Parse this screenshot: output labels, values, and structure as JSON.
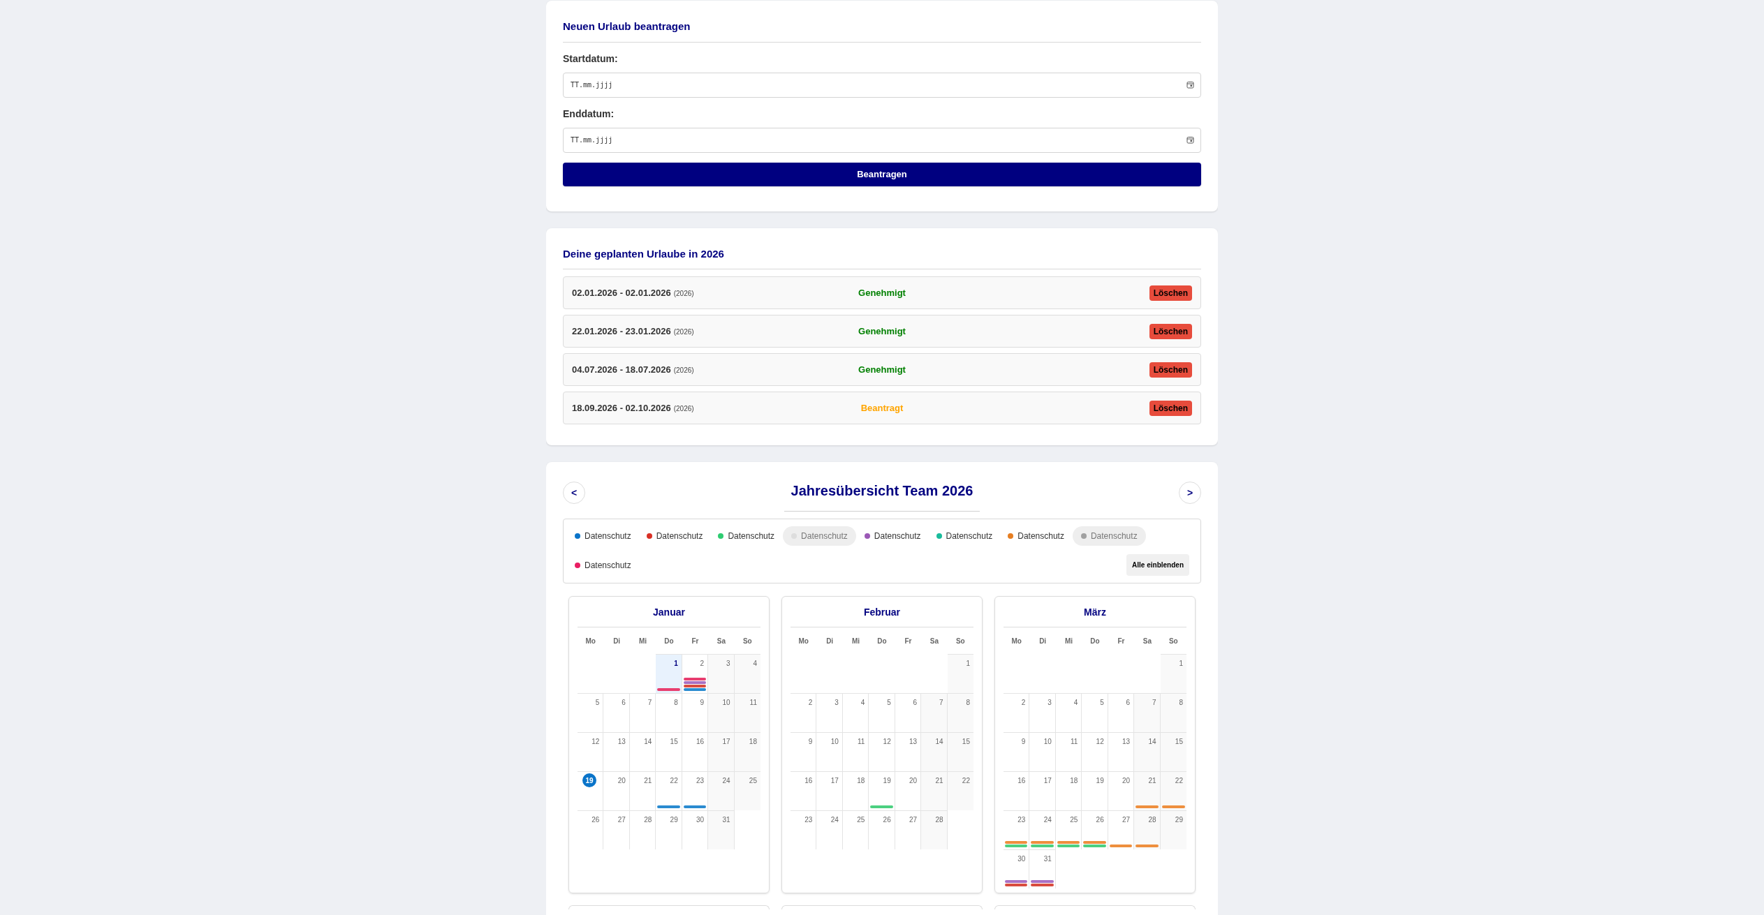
{
  "request_form": {
    "title": "Neuen Urlaub beantragen",
    "fields": [
      {
        "label": "Startdatum:",
        "placeholder": "TT.mm.jjjj"
      },
      {
        "label": "Enddatum:",
        "placeholder": "TT.mm.jjjj"
      }
    ],
    "submit": "Beantragen"
  },
  "planned": {
    "title": "Deine geplanten Urlaube in 2026",
    "items": [
      {
        "range": "02.01.2026 - 02.01.2026",
        "year": "(2026)",
        "status": "Genehmigt",
        "kind": "approved",
        "delete": "Löschen"
      },
      {
        "range": "22.01.2026 - 23.01.2026",
        "year": "(2026)",
        "status": "Genehmigt",
        "kind": "approved",
        "delete": "Löschen"
      },
      {
        "range": "04.07.2026 - 18.07.2026",
        "year": "(2026)",
        "status": "Genehmigt",
        "kind": "approved",
        "delete": "Löschen"
      },
      {
        "range": "18.09.2026 - 02.10.2026",
        "year": "(2026)",
        "status": "Beantragt",
        "kind": "requested",
        "delete": "Löschen"
      }
    ]
  },
  "overview": {
    "prev": "<",
    "title": "Jahresübersicht Team 2026",
    "next": ">",
    "legend": [
      {
        "label": "Datenschutz",
        "color": "#0a74c9",
        "hidden": false
      },
      {
        "label": "Datenschutz",
        "color": "#d93025",
        "hidden": false
      },
      {
        "label": "Datenschutz",
        "color": "#2ecc71",
        "hidden": false
      },
      {
        "label": "Datenschutz",
        "color": "#dddddd",
        "hidden": true
      },
      {
        "label": "Datenschutz",
        "color": "#9b59b6",
        "hidden": false
      },
      {
        "label": "Datenschutz",
        "color": "#1abc9c",
        "hidden": false
      },
      {
        "label": "Datenschutz",
        "color": "#e67e22",
        "hidden": false
      },
      {
        "label": "Datenschutz",
        "color": "#a0a0a0",
        "hidden": true
      },
      {
        "label": "Datenschutz",
        "color": "#e91e63",
        "hidden": false
      }
    ],
    "show_all": "Alle einblenden",
    "months": [
      {
        "name": "Januar",
        "weekdays": [
          "Mo",
          "Di",
          "Mi",
          "Do",
          "Fr",
          "Sa",
          "So"
        ],
        "weeks": [
          [
            {
              "kind": "empty"
            },
            {
              "kind": "empty"
            },
            {
              "kind": "empty"
            },
            {
              "day": "1",
              "kind": "holiday",
              "bars": [
                {
                  "color": "#e83e6f"
                }
              ]
            },
            {
              "day": "2",
              "kind": "weekday",
              "bars": [
                {
                  "color": "#e83e6f"
                },
                {
                  "color": "#a970c4"
                },
                {
                  "color": "#d94c3f"
                },
                {
                  "color": "#2a8bd0"
                }
              ]
            },
            {
              "day": "3",
              "kind": "weekend"
            },
            {
              "day": "4",
              "kind": "weekend"
            }
          ],
          [
            {
              "day": "5",
              "kind": "weekday"
            },
            {
              "day": "6",
              "kind": "weekday"
            },
            {
              "day": "7",
              "kind": "weekday"
            },
            {
              "day": "8",
              "kind": "weekday"
            },
            {
              "day": "9",
              "kind": "weekday"
            },
            {
              "day": "10",
              "kind": "weekend"
            },
            {
              "day": "11",
              "kind": "weekend"
            }
          ],
          [
            {
              "day": "12",
              "kind": "weekday"
            },
            {
              "day": "13",
              "kind": "weekday"
            },
            {
              "day": "14",
              "kind": "weekday"
            },
            {
              "day": "15",
              "kind": "weekday"
            },
            {
              "day": "16",
              "kind": "weekday"
            },
            {
              "day": "17",
              "kind": "weekend"
            },
            {
              "day": "18",
              "kind": "weekend"
            }
          ],
          [
            {
              "day": "19",
              "kind": "today"
            },
            {
              "day": "20",
              "kind": "weekday"
            },
            {
              "day": "21",
              "kind": "weekday"
            },
            {
              "day": "22",
              "kind": "weekday",
              "bars": [
                {
                  "color": "#2a8bd0"
                }
              ]
            },
            {
              "day": "23",
              "kind": "weekday",
              "bars": [
                {
                  "color": "#2a8bd0"
                }
              ]
            },
            {
              "day": "24",
              "kind": "weekend"
            },
            {
              "day": "25",
              "kind": "weekend"
            }
          ],
          [
            {
              "day": "26",
              "kind": "weekday"
            },
            {
              "day": "27",
              "kind": "weekday"
            },
            {
              "day": "28",
              "kind": "weekday"
            },
            {
              "day": "29",
              "kind": "weekday"
            },
            {
              "day": "30",
              "kind": "weekday"
            },
            {
              "day": "31",
              "kind": "weekend"
            },
            {
              "kind": "empty"
            }
          ]
        ]
      },
      {
        "name": "Februar",
        "weekdays": [
          "Mo",
          "Di",
          "Mi",
          "Do",
          "Fr",
          "Sa",
          "So"
        ],
        "weeks": [
          [
            {
              "kind": "empty"
            },
            {
              "kind": "empty"
            },
            {
              "kind": "empty"
            },
            {
              "kind": "empty"
            },
            {
              "kind": "empty"
            },
            {
              "kind": "empty"
            },
            {
              "day": "1",
              "kind": "weekend"
            }
          ],
          [
            {
              "day": "2",
              "kind": "weekday"
            },
            {
              "day": "3",
              "kind": "weekday"
            },
            {
              "day": "4",
              "kind": "weekday"
            },
            {
              "day": "5",
              "kind": "weekday"
            },
            {
              "day": "6",
              "kind": "weekday"
            },
            {
              "day": "7",
              "kind": "weekend"
            },
            {
              "day": "8",
              "kind": "weekend"
            }
          ],
          [
            {
              "day": "9",
              "kind": "weekday"
            },
            {
              "day": "10",
              "kind": "weekday"
            },
            {
              "day": "11",
              "kind": "weekday"
            },
            {
              "day": "12",
              "kind": "weekday"
            },
            {
              "day": "13",
              "kind": "weekday"
            },
            {
              "day": "14",
              "kind": "weekend"
            },
            {
              "day": "15",
              "kind": "weekend"
            }
          ],
          [
            {
              "day": "16",
              "kind": "weekday"
            },
            {
              "day": "17",
              "kind": "weekday"
            },
            {
              "day": "18",
              "kind": "weekday"
            },
            {
              "day": "19",
              "kind": "weekday",
              "bars": [
                {
                  "color": "#4cd080"
                }
              ]
            },
            {
              "day": "20",
              "kind": "weekday"
            },
            {
              "day": "21",
              "kind": "weekend"
            },
            {
              "day": "22",
              "kind": "weekend"
            }
          ],
          [
            {
              "day": "23",
              "kind": "weekday"
            },
            {
              "day": "24",
              "kind": "weekday"
            },
            {
              "day": "25",
              "kind": "weekday"
            },
            {
              "day": "26",
              "kind": "weekday"
            },
            {
              "day": "27",
              "kind": "weekday"
            },
            {
              "day": "28",
              "kind": "weekend"
            },
            {
              "kind": "empty"
            }
          ]
        ]
      },
      {
        "name": "März",
        "weekdays": [
          "Mo",
          "Di",
          "Mi",
          "Do",
          "Fr",
          "Sa",
          "So"
        ],
        "weeks": [
          [
            {
              "kind": "empty"
            },
            {
              "kind": "empty"
            },
            {
              "kind": "empty"
            },
            {
              "kind": "empty"
            },
            {
              "kind": "empty"
            },
            {
              "kind": "empty"
            },
            {
              "day": "1",
              "kind": "weekend"
            }
          ],
          [
            {
              "day": "2",
              "kind": "weekday"
            },
            {
              "day": "3",
              "kind": "weekday"
            },
            {
              "day": "4",
              "kind": "weekday"
            },
            {
              "day": "5",
              "kind": "weekday"
            },
            {
              "day": "6",
              "kind": "weekday"
            },
            {
              "day": "7",
              "kind": "weekend"
            },
            {
              "day": "8",
              "kind": "weekend"
            }
          ],
          [
            {
              "day": "9",
              "kind": "weekday"
            },
            {
              "day": "10",
              "kind": "weekday"
            },
            {
              "day": "11",
              "kind": "weekday"
            },
            {
              "day": "12",
              "kind": "weekday"
            },
            {
              "day": "13",
              "kind": "weekday"
            },
            {
              "day": "14",
              "kind": "weekend"
            },
            {
              "day": "15",
              "kind": "weekend"
            }
          ],
          [
            {
              "day": "16",
              "kind": "weekday"
            },
            {
              "day": "17",
              "kind": "weekday"
            },
            {
              "day": "18",
              "kind": "weekday"
            },
            {
              "day": "19",
              "kind": "weekday"
            },
            {
              "day": "20",
              "kind": "weekday"
            },
            {
              "day": "21",
              "kind": "weekend",
              "bars": [
                {
                  "color": "#ee8f3e"
                }
              ]
            },
            {
              "day": "22",
              "kind": "weekend",
              "bars": [
                {
                  "color": "#ee8f3e"
                }
              ]
            }
          ],
          [
            {
              "day": "23",
              "kind": "weekday",
              "bars": [
                {
                  "color": "#ee8f3e"
                },
                {
                  "color": "#4cd080"
                }
              ]
            },
            {
              "day": "24",
              "kind": "weekday",
              "bars": [
                {
                  "color": "#ee8f3e"
                },
                {
                  "color": "#4cd080"
                }
              ]
            },
            {
              "day": "25",
              "kind": "weekday",
              "bars": [
                {
                  "color": "#ee8f3e"
                },
                {
                  "color": "#4cd080"
                }
              ]
            },
            {
              "day": "26",
              "kind": "weekday",
              "bars": [
                {
                  "color": "#ee8f3e"
                },
                {
                  "color": "#4cd080"
                }
              ]
            },
            {
              "day": "27",
              "kind": "weekday",
              "bars": [
                {
                  "color": "#ee8f3e"
                }
              ]
            },
            {
              "day": "28",
              "kind": "weekend",
              "bars": [
                {
                  "color": "#ee8f3e"
                }
              ]
            },
            {
              "day": "29",
              "kind": "weekend"
            }
          ],
          [
            {
              "day": "30",
              "kind": "weekday",
              "bars": [
                {
                  "color": "#a970c4"
                },
                {
                  "color": "#d94c3f"
                }
              ]
            },
            {
              "day": "31",
              "kind": "weekday",
              "bars": [
                {
                  "color": "#a970c4"
                },
                {
                  "color": "#d94c3f"
                }
              ]
            },
            {
              "kind": "empty"
            },
            {
              "kind": "empty"
            },
            {
              "kind": "empty"
            },
            {
              "kind": "empty"
            },
            {
              "kind": "empty"
            }
          ]
        ]
      }
    ]
  }
}
